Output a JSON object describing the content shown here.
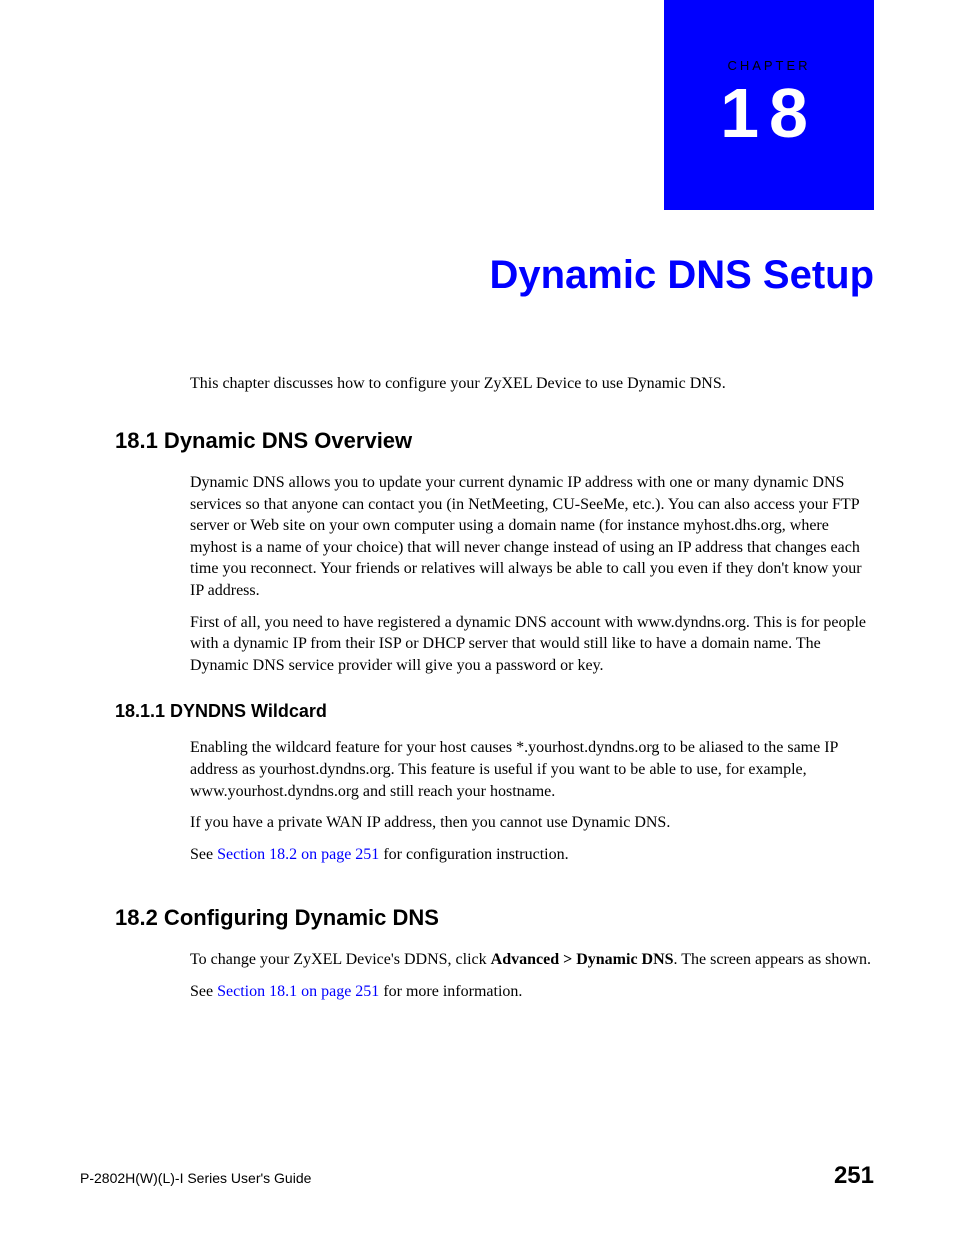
{
  "chapter": {
    "label": "CHAPTER",
    "number": "18",
    "title": "Dynamic DNS Setup"
  },
  "intro": "This chapter discusses how to configure your ZyXEL Device to use Dynamic DNS.",
  "section1": {
    "heading": "18.1  Dynamic DNS Overview",
    "para1": "Dynamic DNS allows you to update your current dynamic IP address with one or many dynamic DNS services so that anyone can contact you (in NetMeeting, CU-SeeMe, etc.). You can also access your FTP server or Web site on your own computer using a domain name (for instance myhost.dhs.org, where myhost is a name of your choice) that will never change instead of using an IP address that changes each time you reconnect. Your friends or relatives will always be able to call you even if they don't know your IP address.",
    "para2": "First of all, you need to have registered a dynamic DNS account with www.dyndns.org. This is for people with a dynamic IP from their ISP or DHCP server that would still like to have a domain name. The Dynamic DNS service provider will give you a password or key."
  },
  "section1_1": {
    "heading": "18.1.1  DYNDNS Wildcard",
    "para1": "Enabling the wildcard feature for your host causes *.yourhost.dyndns.org to be aliased to the same IP address as yourhost.dyndns.org. This feature is useful if you want to be able to use, for example, www.yourhost.dyndns.org and still reach your hostname.",
    "para2": "If you have a private WAN IP address, then you cannot use Dynamic DNS.",
    "para3_prefix": "See ",
    "para3_link": "Section 18.2 on page 251",
    "para3_suffix": " for configuration instruction."
  },
  "section2": {
    "heading": "18.2  Configuring Dynamic DNS",
    "para1_prefix": "To change your ZyXEL Device's DDNS, click ",
    "para1_bold": "Advanced > Dynamic DNS",
    "para1_suffix": ". The screen appears as shown.",
    "para2_prefix": "See ",
    "para2_link": "Section 18.1 on page 251",
    "para2_suffix": " for more information."
  },
  "footer": {
    "guide": "P-2802H(W)(L)-I Series User's Guide",
    "page": "251"
  }
}
